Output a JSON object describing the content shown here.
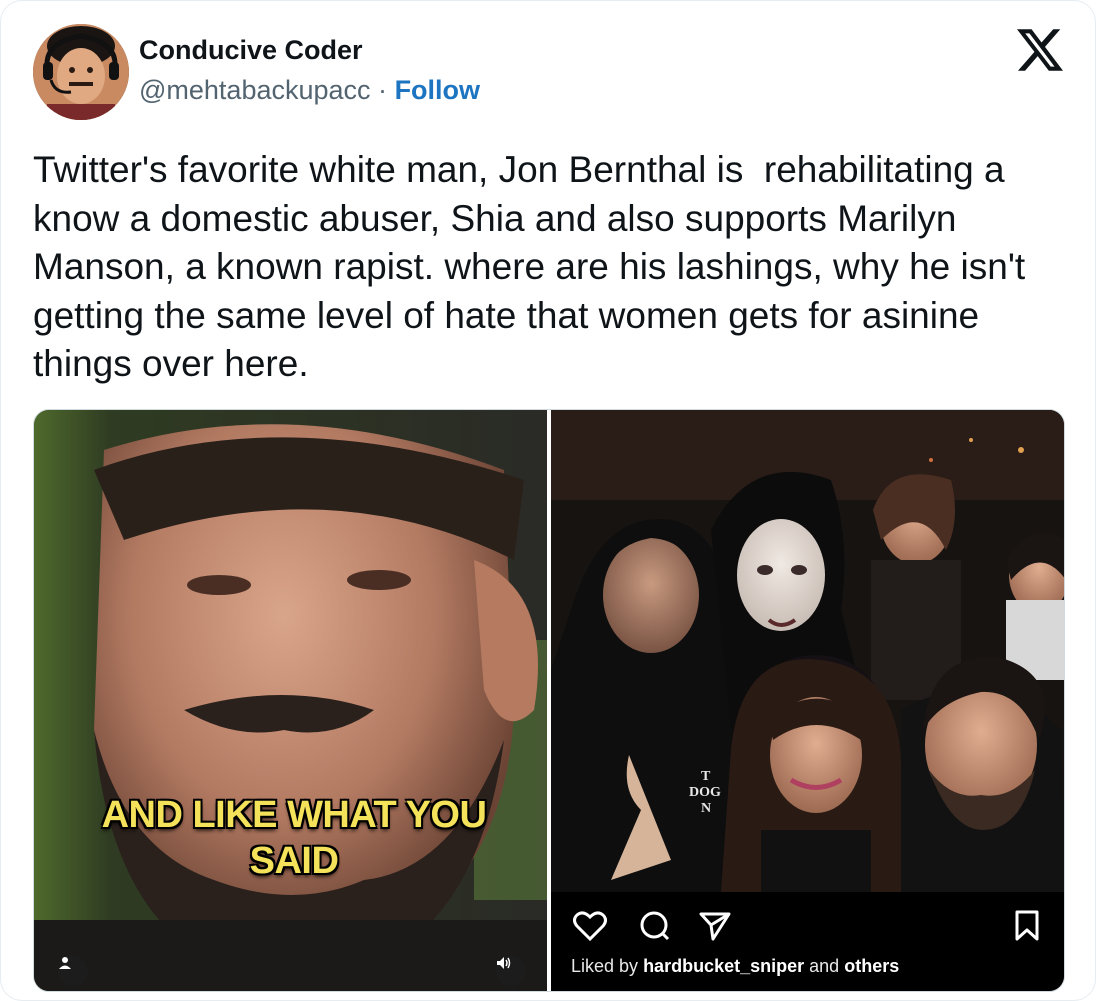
{
  "author": {
    "name": "Conducive Coder",
    "handle": "@mehtabackupacc",
    "separator": "·",
    "follow_label": "Follow"
  },
  "tweet": {
    "text": "Twitter's favorite white man, Jon Bernthal is  rehabilitating a know a domestic abuser, Shia and also supports Marilyn Manson, a known rapist. where are his lashings, why he isn't getting the same level of hate that women gets for asinine things over here."
  },
  "media": {
    "left": {
      "caption": "AND LIKE WHAT YOU SAID",
      "icons": [
        "person-icon",
        "volume-icon"
      ]
    },
    "right": {
      "liked_prefix": "Liked by",
      "liked_user": "hardbucket_sniper",
      "liked_middle": "and",
      "liked_suffix": "others",
      "icons": [
        "heart-icon",
        "comment-icon",
        "share-icon",
        "bookmark-icon"
      ]
    }
  },
  "brand": {
    "logo": "x-logo-icon",
    "link_color": "#1d74c0",
    "caption_color": "#f4e25a"
  }
}
